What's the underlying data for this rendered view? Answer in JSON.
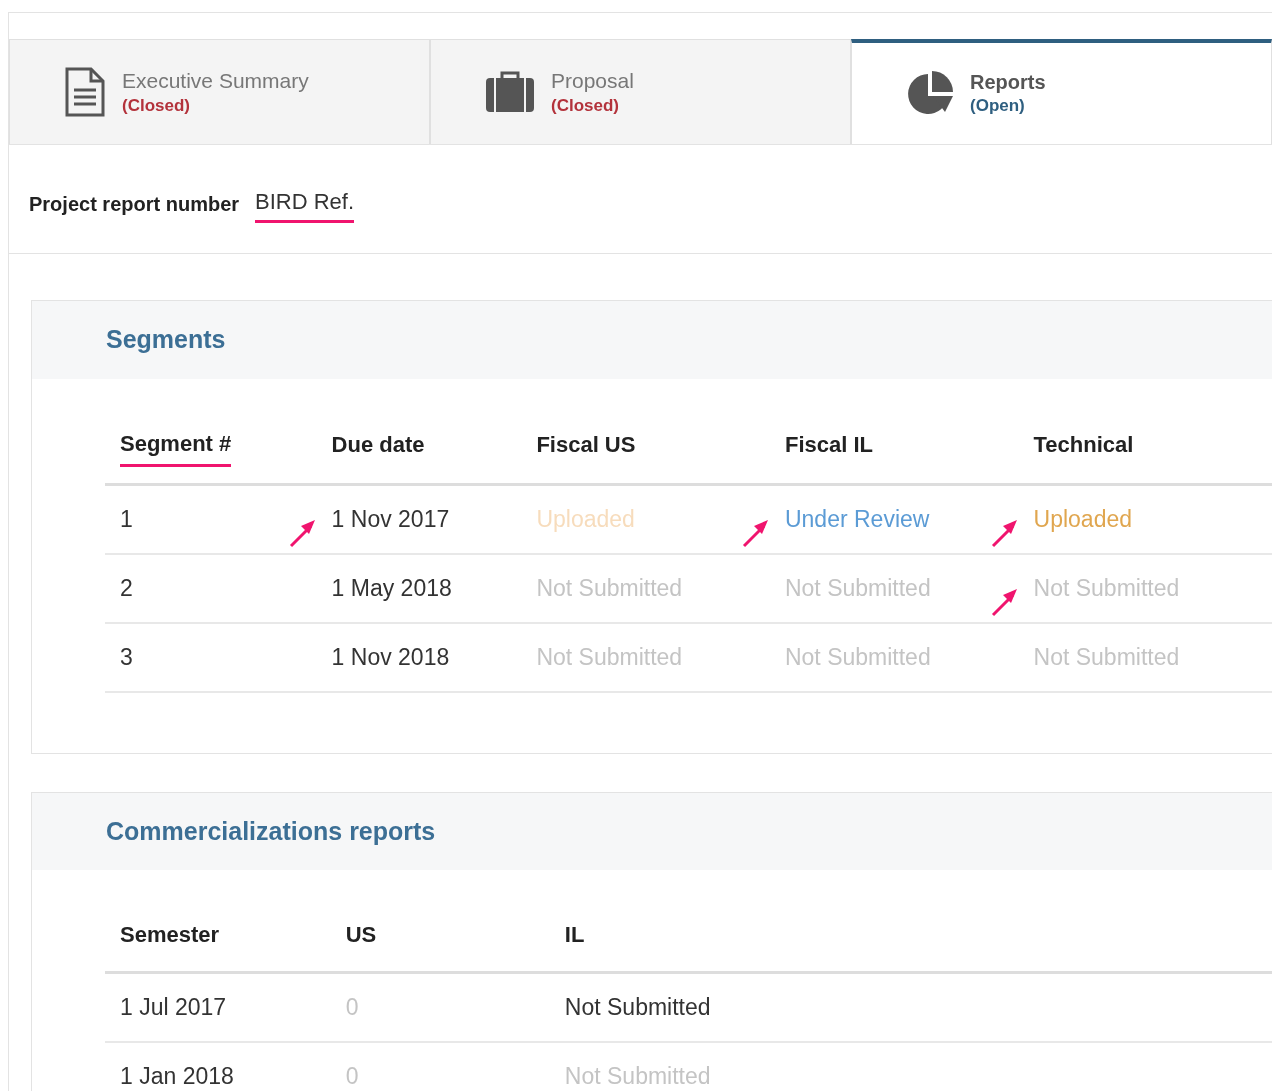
{
  "tabs": [
    {
      "kind": "document",
      "title": "Executive Summary",
      "status": "(Closed)",
      "open": false,
      "selected": false
    },
    {
      "kind": "briefcase",
      "title": "Proposal",
      "status": "(Closed)",
      "open": false,
      "selected": false
    },
    {
      "kind": "pie",
      "title": "Reports",
      "status": "(Open)",
      "open": true,
      "selected": true
    }
  ],
  "report_number": {
    "label": "Project report number",
    "value": "BIRD Ref.",
    "underlined": true
  },
  "segments": {
    "title": "Segments",
    "columns": [
      {
        "label": "Segment #",
        "underlined": true
      },
      {
        "label": "Due date",
        "underlined": false
      },
      {
        "label": "Fiscal US",
        "underlined": false
      },
      {
        "label": "Fiscal IL",
        "underlined": false
      },
      {
        "label": "Technical",
        "underlined": false
      }
    ],
    "rows": [
      [
        {
          "text": "1",
          "kind": "plain"
        },
        {
          "text": "1 Nov 2017",
          "kind": "plain",
          "pointer": true
        },
        {
          "text": "Uploaded",
          "kind": "faded"
        },
        {
          "text": "Under Review",
          "kind": "review",
          "pointer": true
        },
        {
          "text": "Uploaded",
          "kind": "uploaded",
          "pointer": true
        }
      ],
      [
        {
          "text": "2",
          "kind": "plain"
        },
        {
          "text": "1 May 2018",
          "kind": "plain"
        },
        {
          "text": "Not Submitted",
          "kind": "muted"
        },
        {
          "text": "Not Submitted",
          "kind": "muted"
        },
        {
          "text": "Not Submitted",
          "kind": "muted",
          "pointer": true
        }
      ],
      [
        {
          "text": "3",
          "kind": "plain"
        },
        {
          "text": "1 Nov 2018",
          "kind": "plain"
        },
        {
          "text": "Not Submitted",
          "kind": "muted"
        },
        {
          "text": "Not Submitted",
          "kind": "muted"
        },
        {
          "text": "Not Submitted",
          "kind": "muted"
        }
      ]
    ]
  },
  "commercializations": {
    "title": "Commercializations reports",
    "columns": [
      {
        "label": "Semester",
        "underlined": false
      },
      {
        "label": "US",
        "underlined": false
      },
      {
        "label": "IL",
        "underlined": false
      }
    ],
    "rows": [
      [
        {
          "text": "1 Jul 2017",
          "kind": "plain"
        },
        {
          "text": "0",
          "kind": "muted"
        },
        {
          "text": "Not Submitted",
          "kind": "plain"
        }
      ],
      [
        {
          "text": "1 Jan 2018",
          "kind": "plain"
        },
        {
          "text": "0",
          "kind": "muted"
        },
        {
          "text": "Not Submitted",
          "kind": "muted"
        }
      ]
    ]
  }
}
